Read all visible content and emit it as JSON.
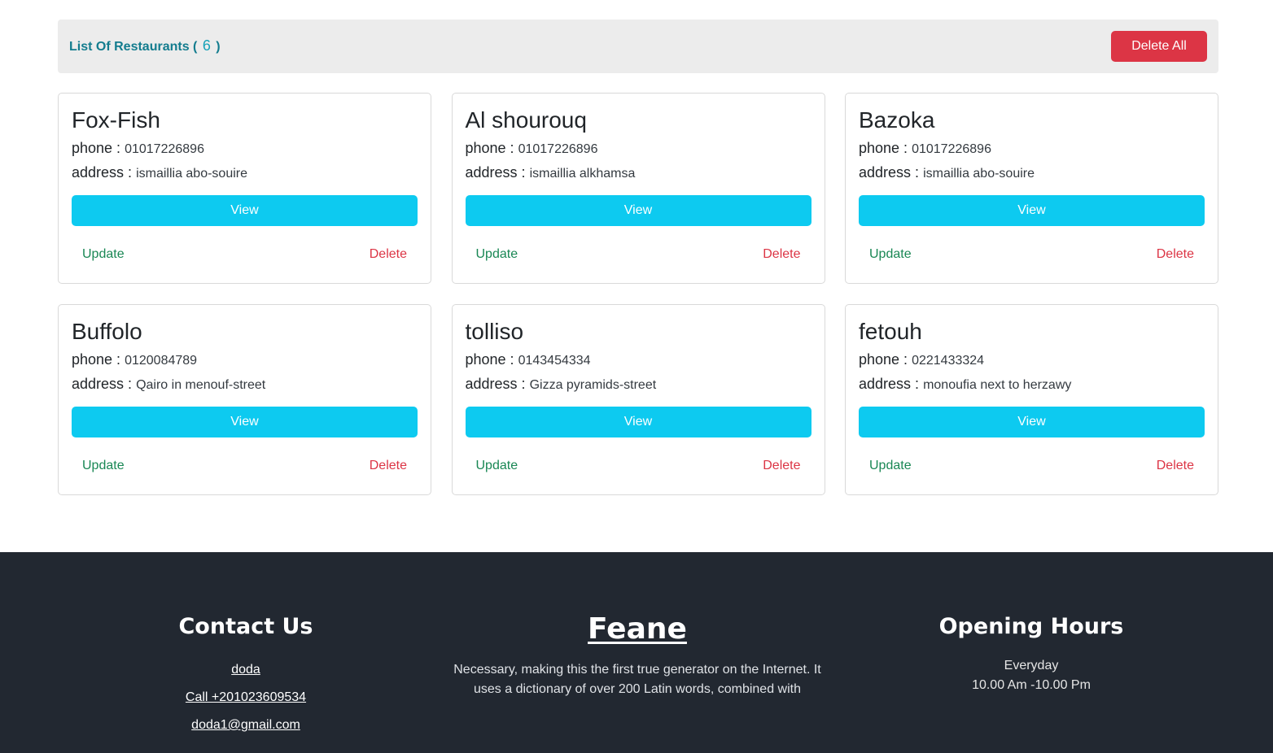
{
  "header": {
    "title_prefix": "List Of Restaurants (",
    "count": "6",
    "title_suffix": ")",
    "delete_all_label": "Delete All"
  },
  "card_labels": {
    "phone": "phone :",
    "address": "address :",
    "view": "View",
    "update": "Update",
    "delete": "Delete"
  },
  "restaurants": [
    {
      "name": "Fox-Fish",
      "phone": "01017226896",
      "address": "ismaillia abo-souire"
    },
    {
      "name": "Al shourouq",
      "phone": "01017226896",
      "address": "ismaillia alkhamsa"
    },
    {
      "name": "Bazoka",
      "phone": "01017226896",
      "address": "ismaillia abo-souire"
    },
    {
      "name": "Buffolo",
      "phone": "0120084789",
      "address": "Qairo in menouf-street"
    },
    {
      "name": "tolliso",
      "phone": "0143454334",
      "address": "Gizza pyramids-street"
    },
    {
      "name": "fetouh",
      "phone": "0221433324",
      "address": "monoufia next to herzawy"
    }
  ],
  "footer": {
    "contact": {
      "heading": "Contact Us",
      "name_link": "doda",
      "call_link": "Call +201023609534",
      "email_link": "doda1@gmail.com"
    },
    "brand": {
      "heading": "Feane",
      "description": "Necessary, making this the first true generator on the Internet. It uses a dictionary of over 200 Latin words, combined with"
    },
    "hours": {
      "heading": "Opening Hours",
      "days": "Everyday",
      "time": "10.00 Am -10.00 Pm"
    }
  },
  "colors": {
    "accent_title": "#137c8e",
    "danger": "#dc3545",
    "info": "#0dcaf0",
    "success": "#198754",
    "footer_bg": "#222831"
  }
}
